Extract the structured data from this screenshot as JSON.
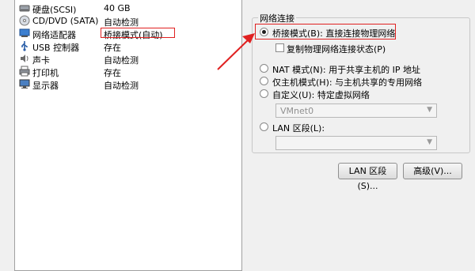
{
  "devices": [
    {
      "name": "硬盘(SCSI)",
      "summary": "40 GB",
      "icon": "hard-disk-icon"
    },
    {
      "name": "CD/DVD (SATA)",
      "summary": "自动检测",
      "icon": "cd-dvd-icon"
    },
    {
      "name": "网络适配器",
      "summary": "桥接模式(自动)",
      "icon": "network-adapter-icon"
    },
    {
      "name": "USB 控制器",
      "summary": "存在",
      "icon": "usb-icon"
    },
    {
      "name": "声卡",
      "summary": "自动检测",
      "icon": "sound-card-icon"
    },
    {
      "name": "打印机",
      "summary": "存在",
      "icon": "printer-icon"
    },
    {
      "name": "显示器",
      "summary": "自动检测",
      "icon": "display-icon"
    }
  ],
  "network": {
    "group_title": "网络连接",
    "bridged_label": "桥接模式(B): 直接连接物理网络",
    "replicate_label": "复制物理网络连接状态(P)",
    "nat_label": "NAT 模式(N): 用于共享主机的 IP 地址",
    "hostonly_label": "仅主机模式(H): 与主机共享的专用网络",
    "custom_label": "自定义(U): 特定虚拟网络",
    "custom_value": "VMnet0",
    "lan_label": "LAN 区段(L):",
    "lan_value": ""
  },
  "buttons": {
    "lan_segments": "LAN 区段(S)...",
    "advanced": "高级(V)..."
  },
  "colors": {
    "annotation_red": "#e02020"
  }
}
